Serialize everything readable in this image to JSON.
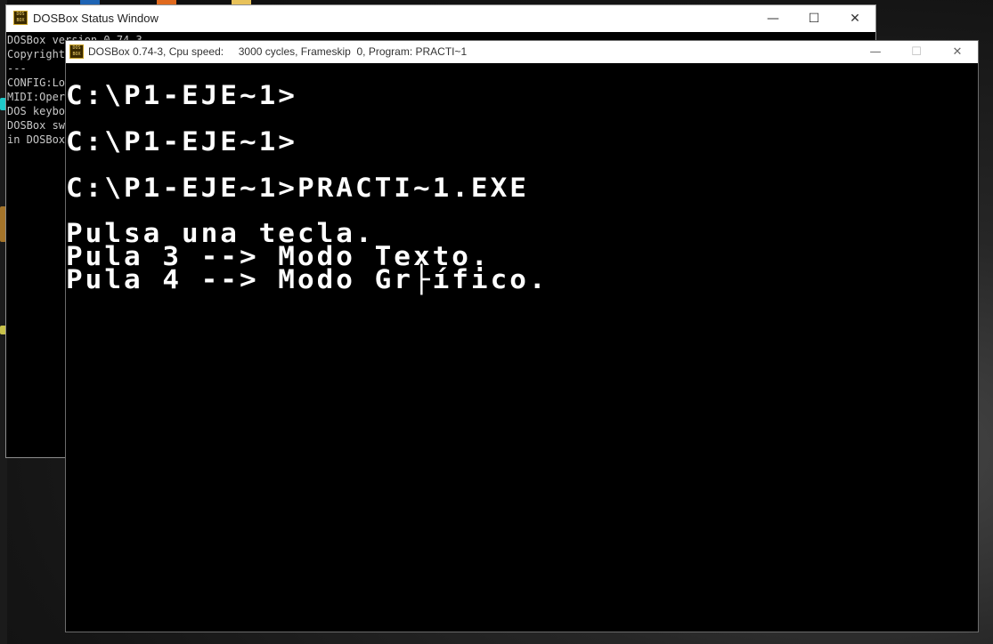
{
  "status_window": {
    "title": "DOSBox Status Window",
    "icon": "dosbox-icon",
    "icon_text": "DOS BOX",
    "controls": {
      "minimize": "—",
      "maximize": "☐",
      "close": "✕"
    },
    "lines": [
      "DOSBox version 0.74-3",
      "Copyright",
      "---",
      "CONFIG:Lo",
      "MIDI:Oper",
      "DOS keybo",
      "DOSBox sw",
      "in DOSBox"
    ]
  },
  "dosbox_window": {
    "title": "DOSBox 0.74-3, Cpu speed:     3000 cycles, Frameskip  0, Program: PRACTI~1",
    "icon": "dosbox-icon",
    "icon_text": "DOS BOX",
    "controls": {
      "minimize": "—",
      "maximize": "☐",
      "close": "✕"
    },
    "screen_lines": [
      "C:\\P1-EJE~1>",
      "C:\\P1-EJE~1>",
      "C:\\P1-EJE~1>PRACTI~1.EXE",
      "Pulsa una tecla.",
      "Pula 3 --> Modo Texto.",
      "Pula 4 --> Modo Gr├ífico."
    ]
  }
}
